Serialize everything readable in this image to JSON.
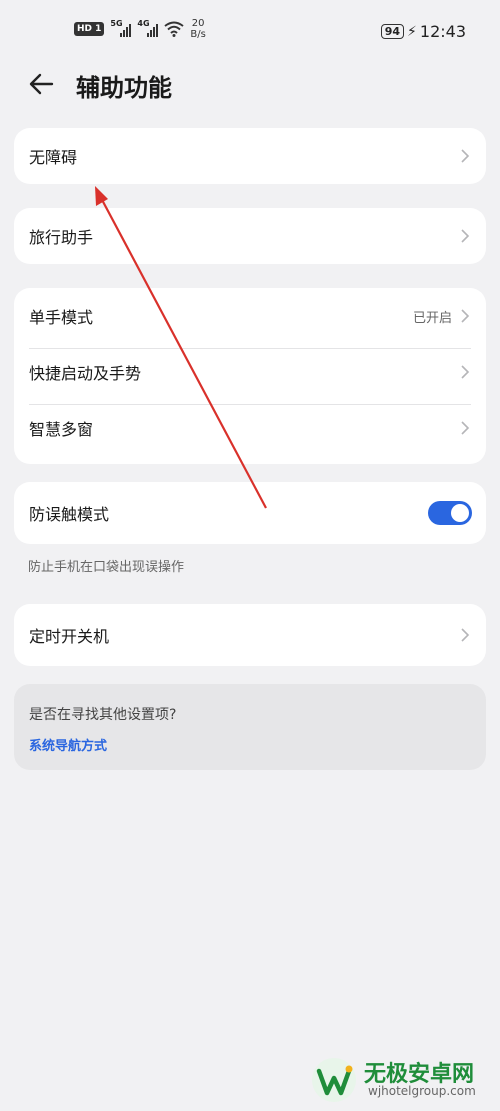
{
  "status_bar": {
    "hd": "HD",
    "sim1": "1",
    "gen1": "5G",
    "gen2": "4G",
    "speed_value": "20",
    "speed_unit": "B/s",
    "battery": "94",
    "time": "12:43"
  },
  "header": {
    "title": "辅助功能",
    "back_icon": "back-arrow-icon"
  },
  "groups": {
    "accessibility": {
      "label": "无障碍"
    },
    "travel": {
      "label": "旅行助手"
    },
    "multi": {
      "one_hand": {
        "label": "单手模式",
        "status": "已开启"
      },
      "shortcuts": {
        "label": "快捷启动及手势"
      },
      "smart_window": {
        "label": "智慧多窗"
      }
    },
    "pocket": {
      "label": "防误触模式",
      "enabled": true,
      "hint": "防止手机在口袋出现误操作"
    },
    "timer": {
      "label": "定时开关机"
    }
  },
  "suggestion": {
    "question": "是否在寻找其他设置项?",
    "link": "系统导航方式"
  },
  "watermark": {
    "title": "无极安卓网",
    "url": "wjhotelgroup.com"
  },
  "colors": {
    "accent": "#2a66e0",
    "annotation": "#d9312b",
    "background": "#f1f1f3"
  }
}
